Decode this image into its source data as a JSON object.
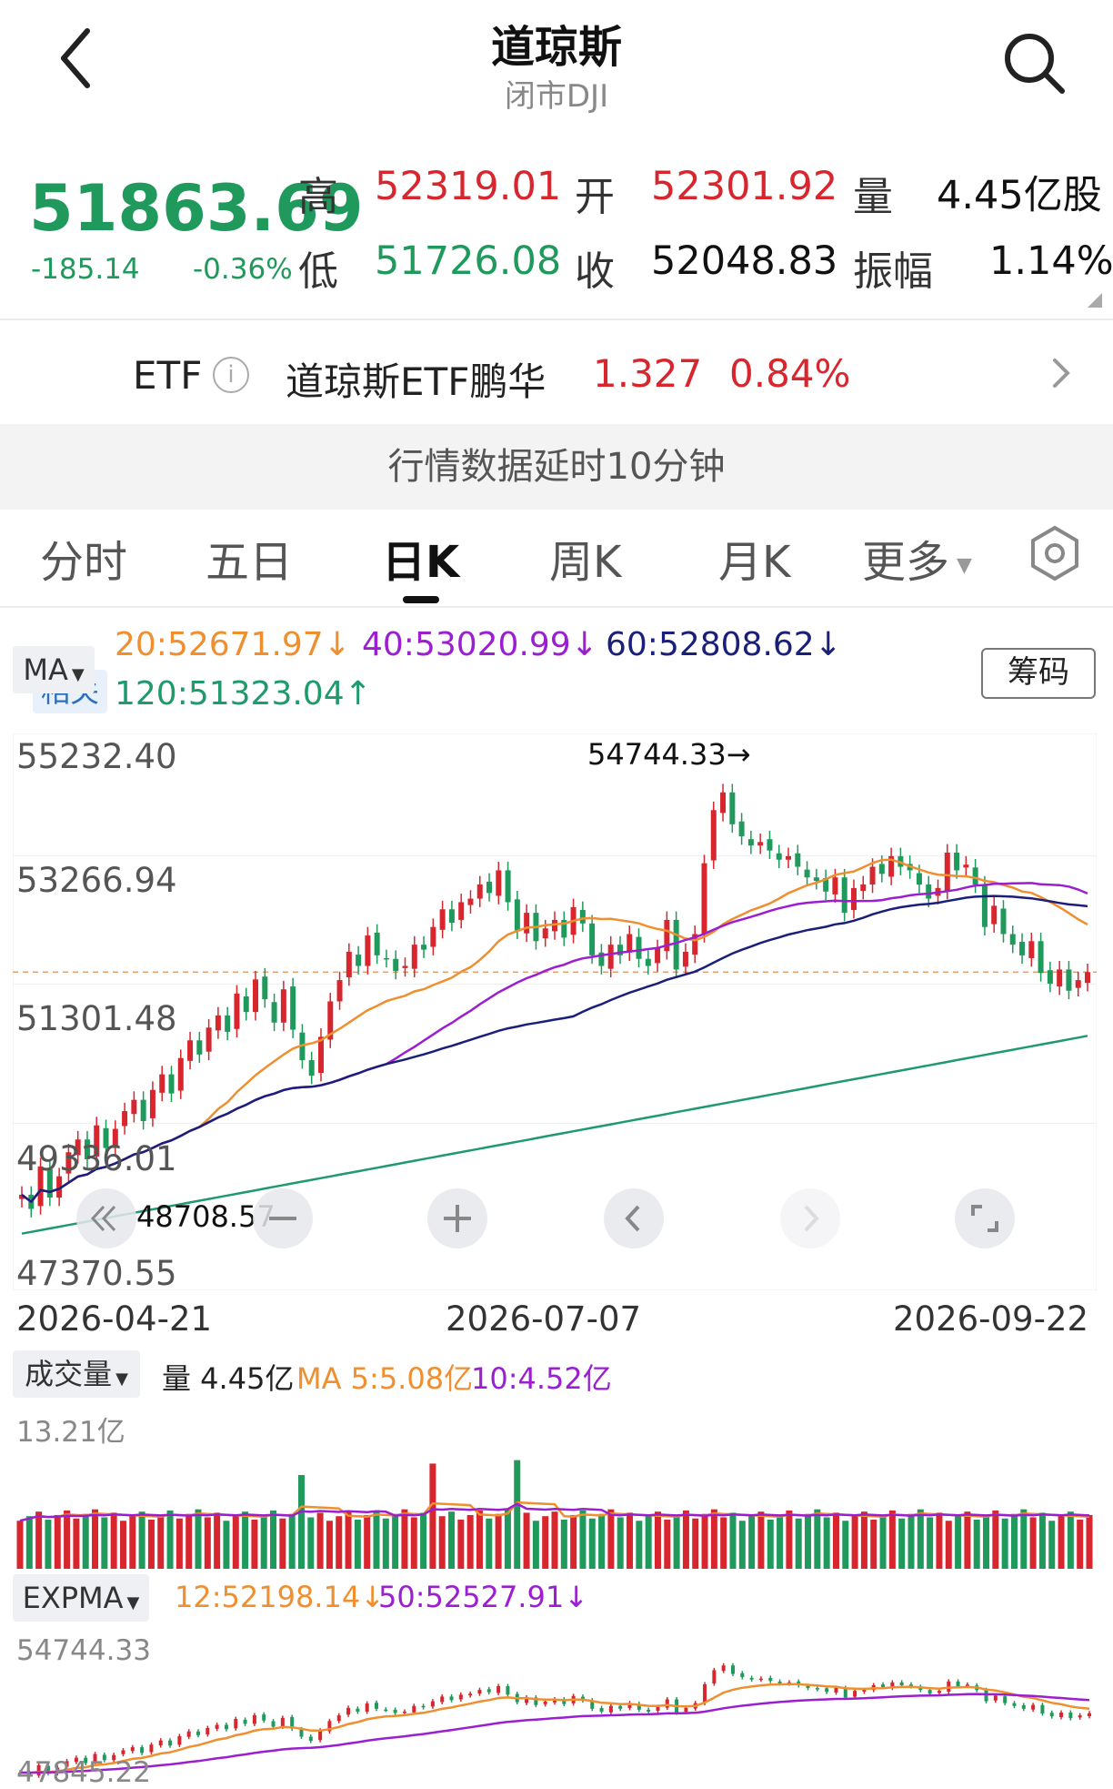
{
  "header": {
    "title": "道琼斯",
    "subtitle": "闭市DJI"
  },
  "quote": {
    "price": "51863.69",
    "change": "-185.14",
    "change_pct": "-0.36%",
    "high_label": "高",
    "high": "52319.01",
    "low_label": "低",
    "low": "51726.08",
    "open_label": "开",
    "open": "52301.92",
    "close_label": "收",
    "close": "52048.83",
    "volume_label": "量",
    "volume": "4.45亿股",
    "amplitude_label": "振幅",
    "amplitude": "1.14%"
  },
  "etf": {
    "tag": "相关",
    "type": "ETF",
    "name": "道琼斯ETF鹏华",
    "price": "1.327",
    "change_pct": "0.84%"
  },
  "notice": "行情数据延时10分钟",
  "tabs": [
    "分时",
    "五日",
    "日K",
    "周K",
    "月K",
    "更多"
  ],
  "active_tab": "日K",
  "ma_row": {
    "select_label": "MA",
    "ma20": "20:52671.97↓",
    "ma40": "40:53020.99↓",
    "ma60": "60:52808.62↓",
    "ma120": "120:51323.04↑",
    "chips_button": "筹码"
  },
  "colors": {
    "up": "#d8262e",
    "down": "#1f9a5c",
    "ma20": "#ef8f2f",
    "ma40": "#9b1fd0",
    "ma60": "#1a1f7a",
    "ma120": "#1f9a6c"
  },
  "kchart": {
    "y_ticks": [
      "55232.40",
      "53266.94",
      "51301.48",
      "49336.01",
      "47370.55"
    ],
    "max_annotation": "54744.33→",
    "min_annotation": "48708.57",
    "dates": [
      "2026-04-21",
      "2026-07-07",
      "2026-09-22"
    ]
  },
  "volume": {
    "select_label": "成交量",
    "vol": "量 4.45亿",
    "ma5": "MA 5:5.08亿",
    "ma10": "10:4.52亿",
    "max_label": "13.21亿"
  },
  "expma": {
    "select_label": "EXPMA",
    "e12": "12:52198.14↓",
    "e50": "50:52527.91↓",
    "max_label": "54744.33",
    "min_label": "47845.22"
  },
  "chart_data": {
    "type": "candlestick",
    "title": "道琼斯",
    "ylim": [
      47370.55,
      55232.4
    ],
    "x_range": [
      "2026-04-21",
      "2026-09-22"
    ],
    "close": [
      48720,
      48520,
      49120,
      48680,
      48980,
      49320,
      49500,
      49220,
      49700,
      49380,
      49650,
      49900,
      50060,
      49760,
      50200,
      50420,
      50150,
      50650,
      50900,
      50700,
      51080,
      51250,
      51020,
      51560,
      51300,
      51760,
      51480,
      51150,
      51620,
      51050,
      50620,
      50400,
      50950,
      51450,
      51750,
      52150,
      51950,
      52380,
      52100,
      52050,
      51880,
      51950,
      52250,
      52180,
      52500,
      52750,
      52560,
      52850,
      52900,
      53100,
      52980,
      53300,
      52850,
      52450,
      52700,
      52300,
      52480,
      52600,
      52350,
      52780,
      52550,
      52100,
      51950,
      52250,
      52100,
      52400,
      52050,
      51950,
      52200,
      52600,
      51900,
      52150,
      52400,
      53400,
      54150,
      54400,
      53950,
      53780,
      53650,
      53700,
      53580,
      53450,
      53500,
      53350,
      53200,
      53150,
      53000,
      53200,
      52700,
      53050,
      53100,
      53350,
      53250,
      53500,
      53350,
      53300,
      53100,
      52900,
      53050,
      53550,
      53300,
      53380,
      53100,
      52500,
      52800,
      52400,
      52250,
      52100,
      52300,
      51850,
      51700,
      51900,
      51600,
      51750,
      51863
    ]
  }
}
